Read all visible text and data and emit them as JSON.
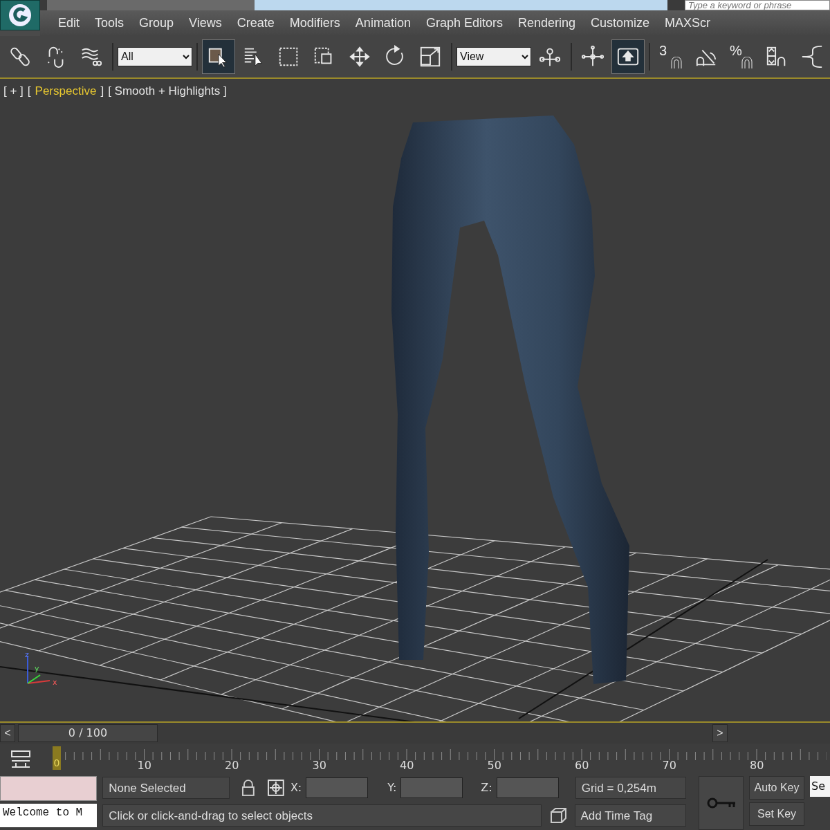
{
  "title_bar": {
    "search": {
      "placeholder": "Type a keyword or phrase"
    }
  },
  "menu": [
    "Edit",
    "Tools",
    "Group",
    "Views",
    "Create",
    "Modifiers",
    "Animation",
    "Graph Editors",
    "Rendering",
    "Customize",
    "MAXScr"
  ],
  "toolbar": [
    {
      "kind": "link",
      "selected": false
    },
    {
      "kind": "unlink",
      "selected": false
    },
    {
      "kind": "bind",
      "selected": false
    },
    {
      "kind": "dropdown",
      "value": "All"
    },
    {
      "kind": "select",
      "selected": true
    },
    {
      "kind": "select-by-name",
      "selected": false
    },
    {
      "kind": "region",
      "selected": false
    },
    {
      "kind": "crossing",
      "selected": false
    },
    {
      "kind": "move",
      "selected": false
    },
    {
      "kind": "rotate",
      "selected": false
    },
    {
      "kind": "scale",
      "selected": false
    },
    {
      "kind": "dropdown",
      "value": "View"
    },
    {
      "kind": "pivot",
      "selected": false
    },
    {
      "kind": "manipulate",
      "selected": false
    },
    {
      "kind": "shortcut",
      "selected": true
    },
    {
      "kind": "snap",
      "label": "3",
      "selected": false
    },
    {
      "kind": "angle-snap",
      "selected": false
    },
    {
      "kind": "snap",
      "label": "%",
      "selected": false
    },
    {
      "kind": "spinner-snap",
      "selected": false
    },
    {
      "kind": "named-selection",
      "selected": false
    }
  ],
  "viewport": {
    "labels": [
      {
        "text": "[ + ]",
        "active": false
      },
      {
        "text": "[",
        "active": false
      },
      {
        "text": "Perspective",
        "active": true
      },
      {
        "text": "]",
        "active": false
      },
      {
        "text": "[ Smooth + Highlights ]",
        "active": false
      }
    ],
    "axis_labels": [
      "z",
      "y",
      "x"
    ]
  },
  "time_slider": {
    "prev": "<",
    "position": "0 / 100",
    "next": ">",
    "level": 0.0
  },
  "track_bar": {
    "current_frame": "0",
    "ticks": [
      "10",
      "20",
      "30",
      "40",
      "50",
      "60",
      "70",
      "80"
    ]
  },
  "status_bar": {
    "maxscript_value": "Welcome to M",
    "selection": "None Selected",
    "x_label": "X:",
    "y_label": "Y:",
    "z_label": "Z:",
    "grid": "Grid = 0,254m",
    "auto_key": "Auto Key",
    "selected_set": "Se",
    "prompt": "Click or click-and-drag to select objects",
    "add_time_tag": "Add Time Tag",
    "set_key": "Set Key"
  }
}
